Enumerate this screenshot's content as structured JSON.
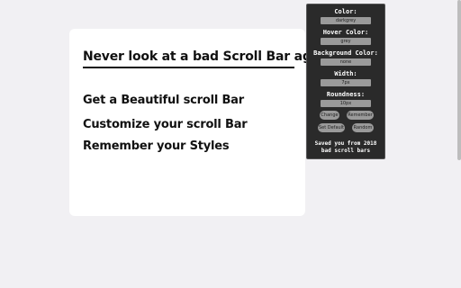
{
  "card": {
    "title": "Never look at a bad Scroll Bar again",
    "features": [
      "Get a Beautiful scroll Bar",
      "Customize your scroll Bar",
      "Remember your Styles"
    ]
  },
  "popup": {
    "color_label": "Color:",
    "color_value": "darkgrey",
    "hover_label": "Hover Color:",
    "hover_value": "grey",
    "bg_label": "Background Color:",
    "bg_value": "none",
    "width_label": "Width:",
    "width_value": "7px",
    "round_label": "Roundness:",
    "round_value": "10px",
    "buttons": {
      "change": "Change",
      "remember": "Remember",
      "set_default": "Set Default",
      "random": "Random"
    },
    "footer_line1": "Saved you from 2018",
    "footer_line2": "bad scroll bars"
  },
  "colors": {
    "page_bg": "#f1f0f3",
    "card_bg": "#ffffff",
    "popup_bg": "#2a2a2a",
    "field_bg": "#9a9a9a",
    "scroll_thumb": "#bdbdbd"
  }
}
